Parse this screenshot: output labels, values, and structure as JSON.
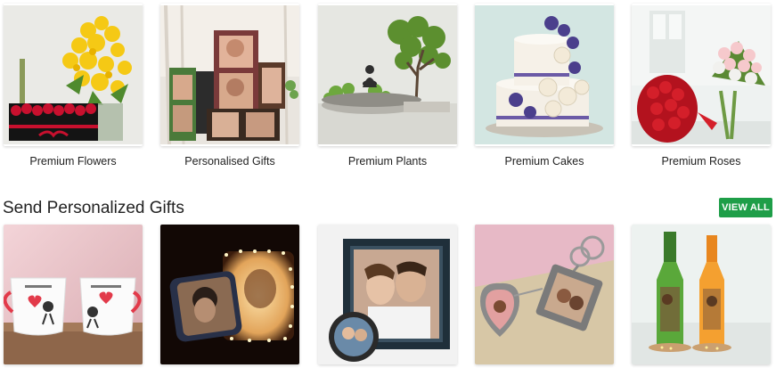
{
  "categories": [
    {
      "label": "Premium Flowers"
    },
    {
      "label": "Personalised Gifts"
    },
    {
      "label": "Premium Plants"
    },
    {
      "label": "Premium Cakes"
    },
    {
      "label": "Premium Roses"
    }
  ],
  "personalized": {
    "title": "Send Personalized Gifts",
    "view_all_label": "VIEW ALL",
    "view_all_color": "#1e9e48",
    "items": [
      {
        "image": "personalized-mugs"
      },
      {
        "image": "personalized-cushion-lamp"
      },
      {
        "image": "personalized-photo-frame"
      },
      {
        "image": "personalized-keychain"
      },
      {
        "image": "personalized-bottles"
      }
    ]
  }
}
